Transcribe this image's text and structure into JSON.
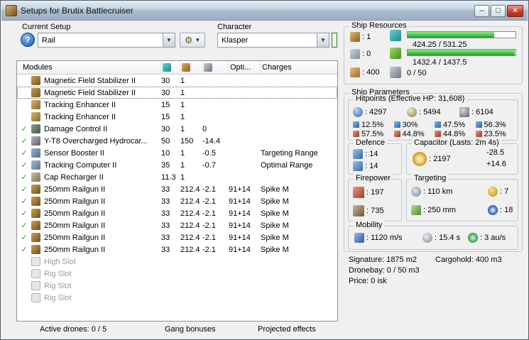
{
  "window": {
    "title": "Setups for Brutix Battlecruiser",
    "minimize_label": "–",
    "maximize_label": "□",
    "close_label": "×"
  },
  "colors": {
    "accent_green": "#00d400",
    "bar_green": "#1f9e1f",
    "check_green": "#2ca22c",
    "close_red": "#c33d26"
  },
  "setup_controls": {
    "current_setup_label": "Current Setup",
    "setup_value": "Rail",
    "character_label": "Character",
    "character_value": "Klasper",
    "help_glyph": "?",
    "tools_glyph": "⚙",
    "dropdown_glyph": "▼"
  },
  "modules_table": {
    "header": {
      "modules": "Modules",
      "opti": "Opti...",
      "charges": "Charges"
    },
    "rows": [
      {
        "icon": "magstab",
        "name": "Magnetic Field Stabilizer II",
        "cpu": "30",
        "pg": "1"
      },
      {
        "icon": "magstab",
        "name": "Magnetic Field Stabilizer II",
        "cpu": "30",
        "pg": "1",
        "selected": true
      },
      {
        "icon": "tracking",
        "name": "Tracking Enhancer II",
        "cpu": "15",
        "pg": "1"
      },
      {
        "icon": "tracking",
        "name": "Tracking Enhancer II",
        "cpu": "15",
        "pg": "1"
      },
      {
        "check": true,
        "icon": "dcu",
        "name": "Damage Control II",
        "cpu": "30",
        "pg": "1",
        "cap": "0"
      },
      {
        "check": true,
        "icon": "mwd",
        "name": "Y-T8 Overcharged Hydrocar...",
        "cpu": "50",
        "pg": "150",
        "cap": "-14.4"
      },
      {
        "check": true,
        "icon": "sebo",
        "name": "Sensor Booster II",
        "cpu": "10",
        "pg": "1",
        "cap": "-0.5",
        "charge": "Targeting Range"
      },
      {
        "check": true,
        "icon": "tc",
        "name": "Tracking Computer II",
        "cpu": "35",
        "pg": "1",
        "cap": "-0.7",
        "charge": "Optimal Range"
      },
      {
        "check": true,
        "icon": "caprecharger",
        "name": "Cap Recharger II",
        "cpu": "11.3",
        "pg": "1"
      },
      {
        "check": true,
        "icon": "railgun",
        "name": "250mm Railgun II",
        "cpu": "33",
        "pg": "212.4",
        "cap": "-2.1",
        "opti": "91+14",
        "charge": "Spike M"
      },
      {
        "check": true,
        "icon": "railgun",
        "name": "250mm Railgun II",
        "cpu": "33",
        "pg": "212.4",
        "cap": "-2.1",
        "opti": "91+14",
        "charge": "Spike M"
      },
      {
        "check": true,
        "icon": "railgun",
        "name": "250mm Railgun II",
        "cpu": "33",
        "pg": "212.4",
        "cap": "-2.1",
        "opti": "91+14",
        "charge": "Spike M"
      },
      {
        "check": true,
        "icon": "railgun",
        "name": "250mm Railgun II",
        "cpu": "33",
        "pg": "212.4",
        "cap": "-2.1",
        "opti": "91+14",
        "charge": "Spike M"
      },
      {
        "check": true,
        "icon": "railgun",
        "name": "250mm Railgun II",
        "cpu": "33",
        "pg": "212.4",
        "cap": "-2.1",
        "opti": "91+14",
        "charge": "Spike M"
      },
      {
        "check": true,
        "icon": "railgun",
        "name": "250mm Railgun II",
        "cpu": "33",
        "pg": "212.4",
        "cap": "-2.1",
        "opti": "91+14",
        "charge": "Spike M"
      },
      {
        "icon": "highslot",
        "name": "High Slot",
        "empty": true
      },
      {
        "icon": "rigslot",
        "name": "Rig Slot",
        "empty": true
      },
      {
        "icon": "rigslot",
        "name": "Rig Slot",
        "empty": true
      },
      {
        "icon": "rigslot",
        "name": "Rig Slot",
        "empty": true
      }
    ]
  },
  "bottom_bar": {
    "active_drones": "Active drones: 0 / 5",
    "gang_bonuses": "Gang bonuses",
    "projected_effects": "Projected effects"
  },
  "ship_resources": {
    "title": "Ship Resources",
    "turrets_free": "1",
    "launchers_free": "0",
    "calibration": "400",
    "cpu_text": "424.25 / 531.25",
    "cpu_pct": 80,
    "powergrid_text": "1432.4 / 1437.5",
    "powergrid_pct": 99.6,
    "dronebay_text": "0 / 50"
  },
  "ship_parameters": {
    "title": "Ship Parameters",
    "hitpoints": {
      "title": "Hitpoints (Effective HP: 31,608)",
      "shield": "4297",
      "armor": "5494",
      "structure": "6104",
      "resists": [
        {
          "top": "12.5%",
          "bottom": "57.5%"
        },
        {
          "top": "30%",
          "bottom": "44.8%"
        },
        {
          "top": "47.5%",
          "bottom": "44.8%"
        },
        {
          "top": "56.3%",
          "bottom": "23.5%"
        }
      ]
    },
    "defence": {
      "title": "Defence",
      "value1": "14",
      "value2": "14"
    },
    "capacitor": {
      "title": "Capacitor (Lasts: 2m 4s)",
      "amount": "2197",
      "out": "-28.5",
      "in": "+14.6"
    },
    "firepower": {
      "title": "Firepower",
      "dps": "197",
      "volley": "735"
    },
    "targeting": {
      "title": "Targeting",
      "range": "110 km",
      "max_targets": "7",
      "scan_resolution": "250 mm",
      "sensor_strength": "18"
    },
    "mobility": {
      "title": "Mobility",
      "speed": "1120 m/s",
      "align_time": "15.4 s",
      "warp_speed": "3 au/s"
    }
  },
  "footer_stats": {
    "signature": "Signature: 1875 m2",
    "cargohold": "Cargohold: 400 m3",
    "dronebay": "Dronebay: 0 / 50 m3",
    "price": "Price: 0 isk"
  }
}
